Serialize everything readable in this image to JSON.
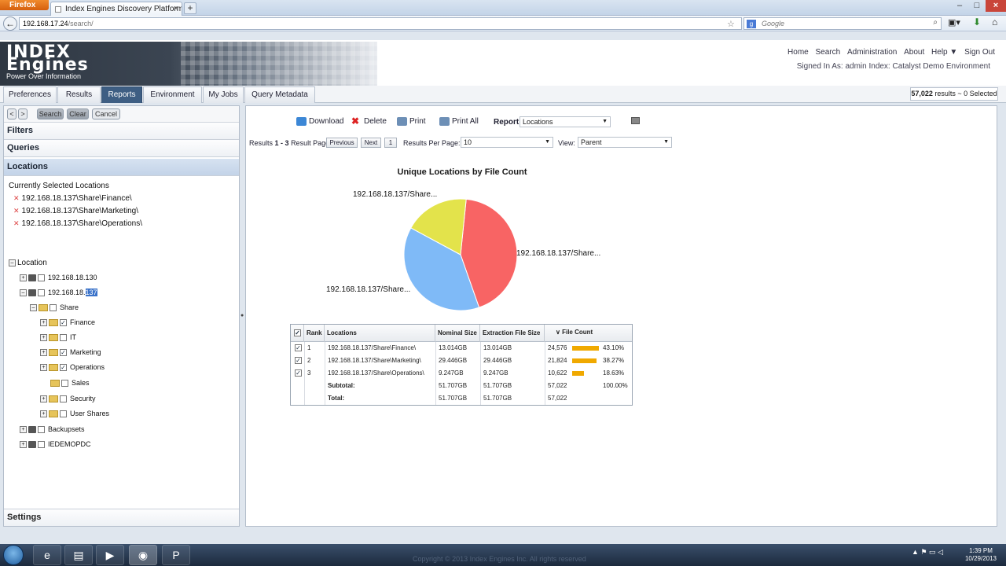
{
  "browser": {
    "app_button": "Firefox",
    "tab_title": "Index Engines Discovery Platform - maple",
    "new_tab": "+",
    "url_domain": "192.168.17.24",
    "url_path": "/search/",
    "search_placeholder": "Google"
  },
  "header": {
    "logo_line1": "INDEX",
    "logo_line2": "Engines",
    "logo_tag": "Power Over Information",
    "links": [
      "Home",
      "Search",
      "Administration",
      "About",
      "Help ▼",
      "Sign Out"
    ],
    "signed_in": "Signed In As: admin Index: Catalyst Demo Environment"
  },
  "tabs": [
    "Preferences",
    "Results",
    "Reports",
    "Environment",
    "My Jobs",
    "Query Metadata"
  ],
  "active_tab": "Reports",
  "result_summary": {
    "count": "57,022",
    "rest": "results ~ 0 Selected"
  },
  "left": {
    "buttons": {
      "back": "<",
      "fwd": ">",
      "search": "Search",
      "clear": "Clear",
      "cancel": "Cancel"
    },
    "sections": {
      "filters": "Filters",
      "queries": "Queries",
      "locations": "Locations",
      "settings": "Settings"
    },
    "current_selected_label": "Currently Selected Locations",
    "selected": [
      "192.168.18.137\\Share\\Finance\\",
      "192.168.18.137\\Share\\Marketing\\",
      "192.168.18.137\\Share\\Operations\\"
    ],
    "tree": {
      "root": "Location",
      "n1": "192.168.18.130",
      "n2_prefix": "192.168.18.",
      "n2_hl": "137",
      "share": "Share",
      "finance": "Finance",
      "it": "IT",
      "marketing": "Marketing",
      "operations": "Operations",
      "sales": "Sales",
      "security": "Security",
      "user_shares": "User Shares",
      "backupsets": "Backupsets",
      "iedemopdc": "IEDEMOPDC"
    }
  },
  "toolbar": {
    "download": "Download",
    "delete": "Delete",
    "print": "Print",
    "print_all": "Print All",
    "report_label": "Report:",
    "report_value": "Locations"
  },
  "paging": {
    "results_prefix": "Results",
    "results_range": "1 - 3",
    "result_page": "Result Page:",
    "previous": "Previous",
    "next": "Next",
    "page": "1",
    "per_page_label": "Results Per Page:",
    "per_page_value": "10",
    "view_label": "View:",
    "view_value": "Parent"
  },
  "chart_data": {
    "type": "pie",
    "title": "Unique Locations by File Count",
    "labels": [
      "192.168.18.137/Share...",
      "192.168.18.137/Share...",
      "192.168.18.137/Share..."
    ],
    "values": [
      43.1,
      38.27,
      18.63
    ],
    "colors": [
      "#f86464",
      "#7fbaf7",
      "#e3e34b"
    ]
  },
  "table": {
    "headers": [
      "Rank",
      "Locations",
      "Nominal Size",
      "Extraction File Size",
      "File Count"
    ],
    "rows": [
      {
        "rank": "1",
        "loc": "192.168.18.137/Share\\Finance\\",
        "nominal": "13.014GB",
        "extract": "13.014GB",
        "count": "24,576",
        "pct": "43.10%",
        "frac": 0.431
      },
      {
        "rank": "2",
        "loc": "192.168.18.137/Share\\Marketing\\",
        "nominal": "29.446GB",
        "extract": "29.446GB",
        "count": "21,824",
        "pct": "38.27%",
        "frac": 0.3827
      },
      {
        "rank": "3",
        "loc": "192.168.18.137/Share\\Operations\\",
        "nominal": "9.247GB",
        "extract": "9.247GB",
        "count": "10,622",
        "pct": "18.63%",
        "frac": 0.1863
      }
    ],
    "subtotal": {
      "label": "Subtotal:",
      "nominal": "51.707GB",
      "extract": "51.707GB",
      "count": "57,022",
      "pct": "100.00%"
    },
    "total": {
      "label": "Total:",
      "nominal": "51.707GB",
      "extract": "51.707GB",
      "count": "57,022"
    }
  },
  "taskbar": {
    "copyright": "Copyright © 2013 Index Engines Inc. All rights reserved",
    "time": "1:39 PM",
    "date": "10/29/2013"
  }
}
